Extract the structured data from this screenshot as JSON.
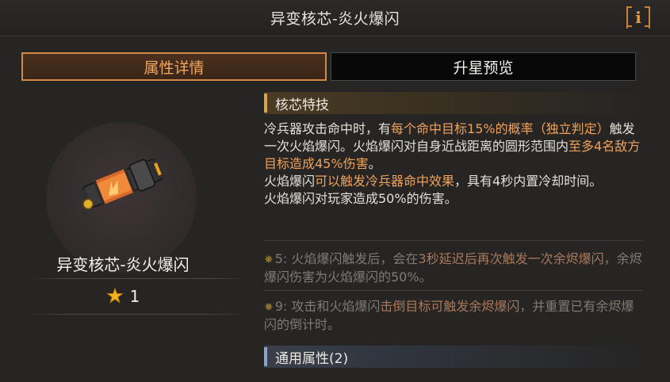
{
  "header": {
    "title": "异变核芯-炎火爆闪",
    "info_label": "i"
  },
  "tabs": [
    {
      "label": "属性详情",
      "active": true
    },
    {
      "label": "升星预览",
      "active": false
    }
  ],
  "item": {
    "name": "异变核芯-炎火爆闪",
    "star_level": "1",
    "icon": "incendiary-core-icon"
  },
  "core_skill": {
    "heading": "核芯特技",
    "desc": [
      {
        "t": "冷兵器攻击命中时，有",
        "hl": false
      },
      {
        "t": "每个命中目标15%的概率（独立判定）",
        "hl": true
      },
      {
        "t": "触发一次火焰爆闪。火焰爆闪对自身近战距离的圆形范围内",
        "hl": false
      },
      {
        "t": "至多4名敌方目标造成45%伤害",
        "hl": true
      },
      {
        "t": "。",
        "hl": false
      },
      {
        "t": "火焰爆闪",
        "hl": false
      },
      {
        "t": "可以触发冷兵器命中效果",
        "hl": true
      },
      {
        "t": "，具有4秒内置冷却时间。",
        "hl": false
      },
      {
        "t": "火焰爆闪对玩家造成50%的伤害。",
        "hl": false
      }
    ]
  },
  "tiers": [
    {
      "star": "5",
      "segments": [
        {
          "t": "5: 火焰爆闪触发后，会在",
          "hl": false
        },
        {
          "t": "3秒延迟后再次触发一次余烬爆闪",
          "hl": true
        },
        {
          "t": "，余烬爆闪伤害为火焰爆闪的50%。",
          "hl": false
        }
      ]
    },
    {
      "star": "9",
      "segments": [
        {
          "t": "9: 攻击和火焰爆闪",
          "hl": false
        },
        {
          "t": "击倒目标可触发余烬爆闪",
          "hl": true
        },
        {
          "t": "，并重置已有余烬爆闪的倒计时。",
          "hl": false
        }
      ]
    }
  ],
  "general": {
    "heading": "通用属性(2)"
  },
  "colors": {
    "accent": "#d08a43",
    "highlight": "#f0a15a",
    "star": "#f3b21e",
    "background": "#262524"
  }
}
